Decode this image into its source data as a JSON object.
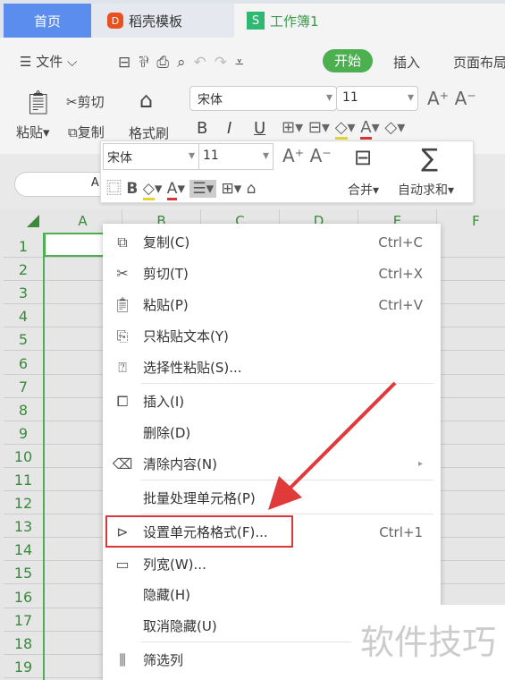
{
  "tabs": [
    {
      "label": "首页"
    },
    {
      "label": "稻壳模板"
    },
    {
      "label": "工作簿1"
    }
  ],
  "toolbar": {
    "file": "文件",
    "start": "开始",
    "insert": "插入",
    "page_layout": "页面布局"
  },
  "ribbon": {
    "paste": "粘贴",
    "cut": "剪切",
    "copy": "复制",
    "format_painter": "格式刷",
    "font": "宋体",
    "size": "11",
    "bold": "B",
    "italic": "I",
    "underline": "U"
  },
  "mini_toolbar": {
    "font": "宋体",
    "size": "11",
    "bold": "B",
    "merge": "合并",
    "autosum": "自动求和"
  },
  "name_box": "A1",
  "columns": [
    "A",
    "B",
    "C",
    "D",
    "E",
    "F"
  ],
  "rows": [
    "1",
    "2",
    "3",
    "4",
    "5",
    "6",
    "7",
    "8",
    "9",
    "10",
    "11",
    "12",
    "13",
    "14",
    "15",
    "16",
    "17",
    "18",
    "19"
  ],
  "context_menu": [
    {
      "label": "复制(C)",
      "shortcut": "Ctrl+C",
      "icon": "copy-icon"
    },
    {
      "label": "剪切(T)",
      "shortcut": "Ctrl+X",
      "icon": "scissors-icon"
    },
    {
      "label": "粘贴(P)",
      "shortcut": "Ctrl+V",
      "icon": "paste-icon"
    },
    {
      "label": "只粘贴文本(Y)",
      "shortcut": "",
      "icon": "paste-text-icon"
    },
    {
      "label": "选择性粘贴(S)...",
      "shortcut": "",
      "icon": "paste-special-icon"
    },
    {
      "label": "插入(I)",
      "shortcut": "",
      "icon": "insert-icon"
    },
    {
      "label": "删除(D)",
      "shortcut": "",
      "icon": ""
    },
    {
      "label": "清除内容(N)",
      "shortcut": "",
      "icon": "eraser-icon"
    },
    {
      "label": "批量处理单元格(P)",
      "shortcut": "",
      "icon": ""
    },
    {
      "label": "设置单元格格式(F)...",
      "shortcut": "Ctrl+1",
      "icon": "format-cells-icon"
    },
    {
      "label": "列宽(W)...",
      "shortcut": "",
      "icon": "column-width-icon"
    },
    {
      "label": "隐藏(H)",
      "shortcut": "",
      "icon": ""
    },
    {
      "label": "取消隐藏(U)",
      "shortcut": "",
      "icon": ""
    },
    {
      "label": "筛选列",
      "shortcut": "",
      "icon": "filter-column-icon"
    }
  ],
  "watermark": "软件技巧",
  "colors": {
    "accent_green": "#4caf50",
    "home_tab": "#4a86e8",
    "highlight_red": "#d9373a"
  }
}
